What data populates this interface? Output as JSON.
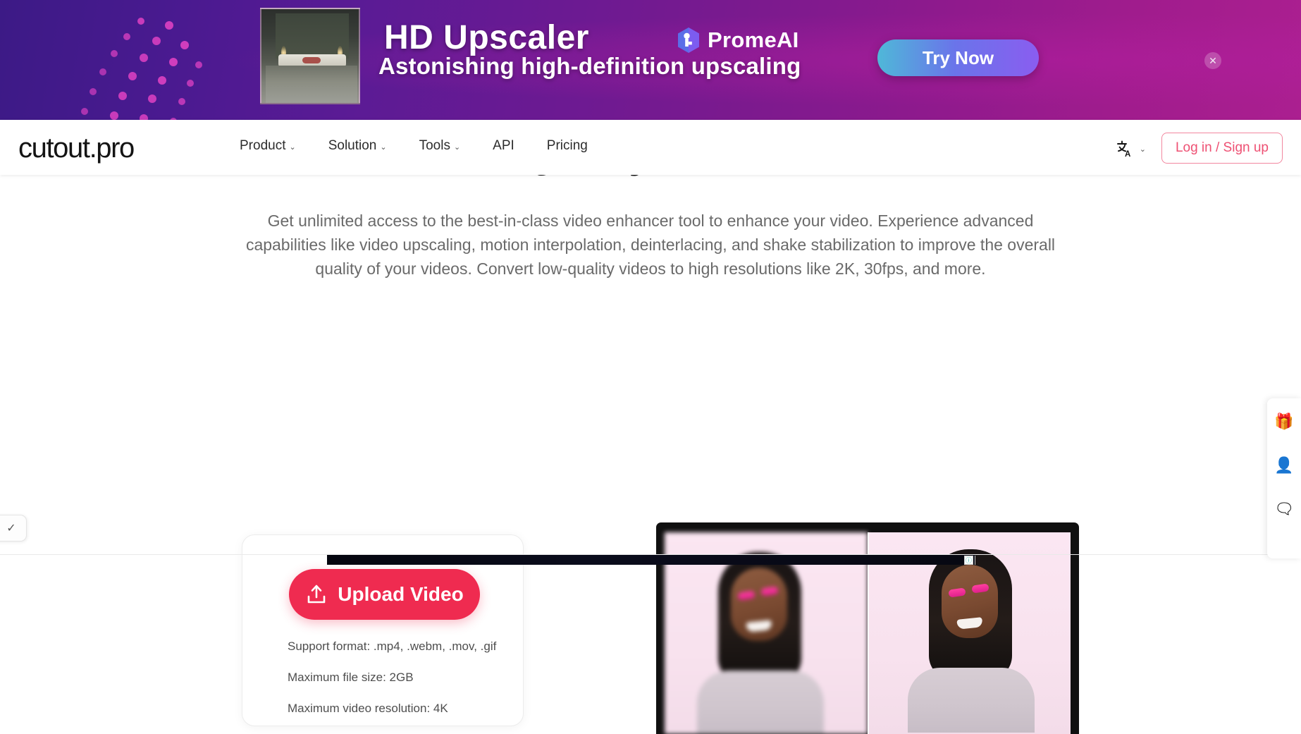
{
  "ad_banner": {
    "headline": "HD Upscaler",
    "subline": "Astonishing high-definition upscaling",
    "brand": "PromeAI",
    "cta_label": "Try Now",
    "close_label": "✕",
    "colors": {
      "gradient_start": "#3c1a86",
      "gradient_end": "#ab1f90",
      "cta_start": "#4fb8d8",
      "cta_end": "#8a5df0"
    }
  },
  "navbar": {
    "logo": "cutout.pro",
    "links": [
      {
        "label": "Product",
        "caret": "⌄"
      },
      {
        "label": "Solution",
        "caret": "⌄"
      },
      {
        "label": "Tools",
        "caret": "⌄"
      },
      {
        "label": "API",
        "caret": ""
      },
      {
        "label": "Pricing",
        "caret": ""
      }
    ],
    "language_caret": "⌄",
    "login_label": "Log in / Sign up",
    "accent_color": "#ee5073"
  },
  "hero": {
    "title": "Quality Online",
    "description": "Get unlimited access to the best-in-class video enhancer tool to enhance your video. Experience advanced capabilities like video upscaling, motion interpolation, deinterlacing, and shake stabilization to improve the overall quality of your videos. Convert low-quality videos to high resolutions like 2K, 30fps, and more."
  },
  "upload_card": {
    "button_label": "Upload Video",
    "button_color": "#ef2b50",
    "notes": [
      "Support format: .mp4, .webm, .mov, .gif",
      "Maximum file size: 2GB",
      "Maximum video resolution: 4K"
    ]
  },
  "video_preview": {
    "left_label": "",
    "right_label": ""
  },
  "right_rail": {
    "items": [
      {
        "icon": "gift-icon",
        "glyph": "🎁"
      },
      {
        "icon": "face-support-icon",
        "glyph": "👤"
      },
      {
        "icon": "feedback-icon",
        "glyph": "🗨"
      }
    ]
  },
  "corner_tab": {
    "glyph": "✓"
  },
  "bottom_ad": {
    "badges": [
      "ⓘ",
      "ⓘ"
    ]
  }
}
